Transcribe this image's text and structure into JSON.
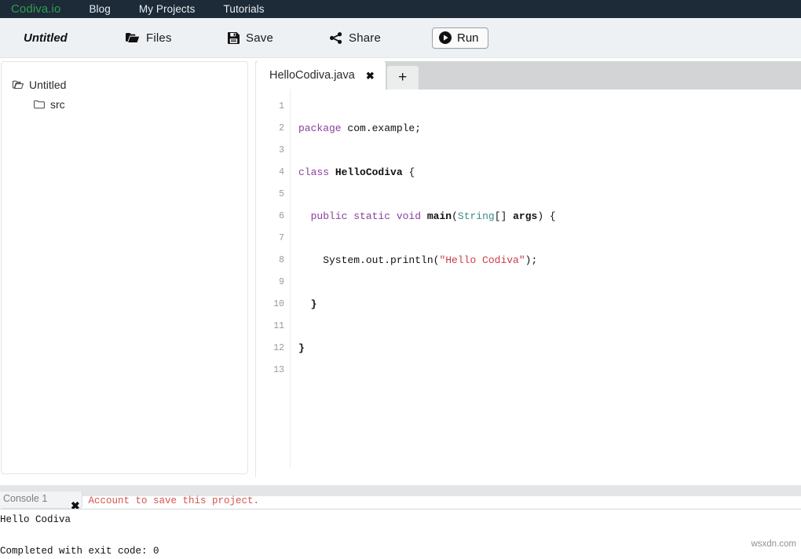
{
  "topnav": {
    "brand": "Codiva.io",
    "brand_color": "#2f9e4f",
    "background": "#1d2a38",
    "links": [
      {
        "label": "Blog"
      },
      {
        "label": "My Projects"
      },
      {
        "label": "Tutorials"
      }
    ]
  },
  "toolbar": {
    "project_title": "Untitled",
    "files_label": "Files",
    "save_label": "Save",
    "share_label": "Share",
    "run_label": "Run"
  },
  "sidebar": {
    "tree": [
      {
        "label": "Untitled",
        "icon": "folder-open-icon",
        "depth": 0
      },
      {
        "label": "src",
        "icon": "folder-icon",
        "depth": 1
      }
    ]
  },
  "editor": {
    "tabs": [
      {
        "label": "HelloCodiva.java",
        "close": "✖",
        "active": true
      }
    ],
    "add_tab_label": "+",
    "line_numbers": [
      "1",
      "2",
      "3",
      "4",
      "5",
      "6",
      "7",
      "8",
      "9",
      "10",
      "11",
      "12",
      "13"
    ],
    "code_lines": [
      {
        "n": 1,
        "segments": []
      },
      {
        "n": 2,
        "segments": [
          {
            "t": "package",
            "c": "kw"
          },
          {
            "t": " com.example;",
            "c": "pln"
          }
        ]
      },
      {
        "n": 3,
        "segments": []
      },
      {
        "n": 4,
        "segments": [
          {
            "t": "class",
            "c": "kw"
          },
          {
            "t": " ",
            "c": "pln"
          },
          {
            "t": "HelloCodiva",
            "c": "bld"
          },
          {
            "t": " {",
            "c": "pln"
          }
        ]
      },
      {
        "n": 5,
        "segments": []
      },
      {
        "n": 6,
        "segments": [
          {
            "t": "  ",
            "c": "pln"
          },
          {
            "t": "public static void",
            "c": "kw"
          },
          {
            "t": " ",
            "c": "pln"
          },
          {
            "t": "main",
            "c": "bld"
          },
          {
            "t": "(",
            "c": "pln"
          },
          {
            "t": "String",
            "c": "typ"
          },
          {
            "t": "[] ",
            "c": "pln"
          },
          {
            "t": "args",
            "c": "bld"
          },
          {
            "t": ") {",
            "c": "pln"
          }
        ]
      },
      {
        "n": 7,
        "segments": []
      },
      {
        "n": 8,
        "segments": [
          {
            "t": "    System.out.println(",
            "c": "pln"
          },
          {
            "t": "\"Hello Codiva\"",
            "c": "str"
          },
          {
            "t": ");",
            "c": "pln"
          }
        ]
      },
      {
        "n": 9,
        "segments": []
      },
      {
        "n": 10,
        "segments": [
          {
            "t": "  ",
            "c": "pln"
          },
          {
            "t": "}",
            "c": "bld"
          }
        ]
      },
      {
        "n": 11,
        "segments": []
      },
      {
        "n": 12,
        "segments": [
          {
            "t": "}",
            "c": "bld"
          }
        ]
      },
      {
        "n": 13,
        "segments": []
      }
    ]
  },
  "console": {
    "login_warning": "Login / Create Account to save this project.",
    "tab_label": "Console 1",
    "close": "✖",
    "output": "Hello Codiva\n\nCompleted with exit code: 0"
  },
  "watermark": "wsxdn.com"
}
